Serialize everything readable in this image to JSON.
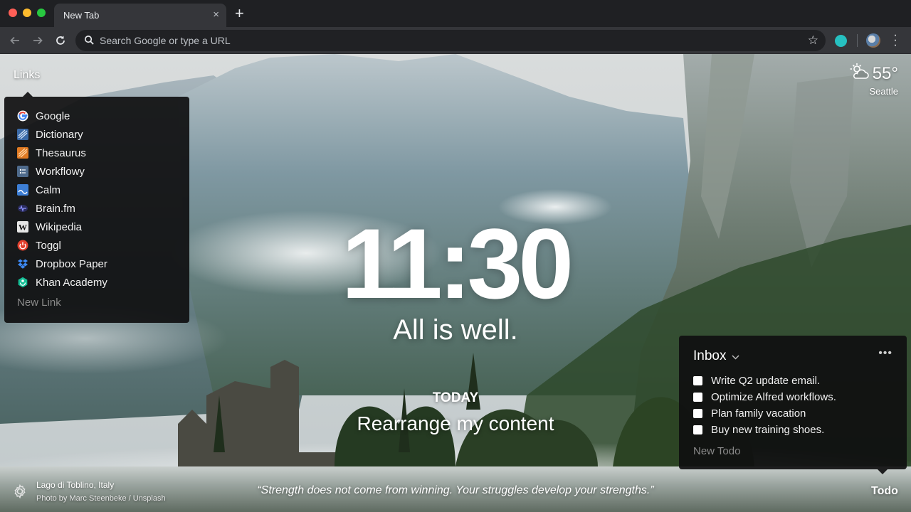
{
  "browser": {
    "tab_title": "New Tab",
    "tab_close": "×",
    "new_tab": "+",
    "omnibox_placeholder": "Search Google or type a URL",
    "bookmark_star": "☆"
  },
  "links": {
    "label": "Links",
    "items": [
      {
        "label": "Google",
        "icon": "google-icon"
      },
      {
        "label": "Dictionary",
        "icon": "dictionary-icon"
      },
      {
        "label": "Thesaurus",
        "icon": "thesaurus-icon"
      },
      {
        "label": "Workflowy",
        "icon": "workflowy-icon"
      },
      {
        "label": "Calm",
        "icon": "calm-icon"
      },
      {
        "label": "Brain.fm",
        "icon": "brainfm-icon"
      },
      {
        "label": "Wikipedia",
        "icon": "wikipedia-icon"
      },
      {
        "label": "Toggl",
        "icon": "toggl-icon"
      },
      {
        "label": "Dropbox Paper",
        "icon": "dropbox-icon"
      },
      {
        "label": "Khan Academy",
        "icon": "khan-academy-icon"
      }
    ],
    "new_link": "New Link"
  },
  "weather": {
    "temp": "55°",
    "city": "Seattle",
    "icon": "partly-cloudy-icon"
  },
  "clock": "11:30",
  "mantra": "All is well.",
  "focus": {
    "label": "TODAY",
    "text": "Rearrange my content"
  },
  "todo": {
    "list_name": "Inbox",
    "more": "•••",
    "items": [
      "Write Q2 update email.",
      "Optimize Alfred workflows.",
      "Plan family vacation",
      "Buy new training shoes."
    ],
    "new_todo": "New Todo",
    "toggle_label": "Todo"
  },
  "photo": {
    "location": "Lago di Toblino, Italy",
    "credit": "Photo by Marc Steenbeke / Unsplash"
  },
  "quote": "“Strength does not come from winning. Your struggles develop your strengths.”",
  "colors": {
    "chrome_dark": "#1f2023",
    "toolbar": "#35363a",
    "panel_bg": "#0f0f10",
    "accent_teal": "#26c1c1"
  }
}
